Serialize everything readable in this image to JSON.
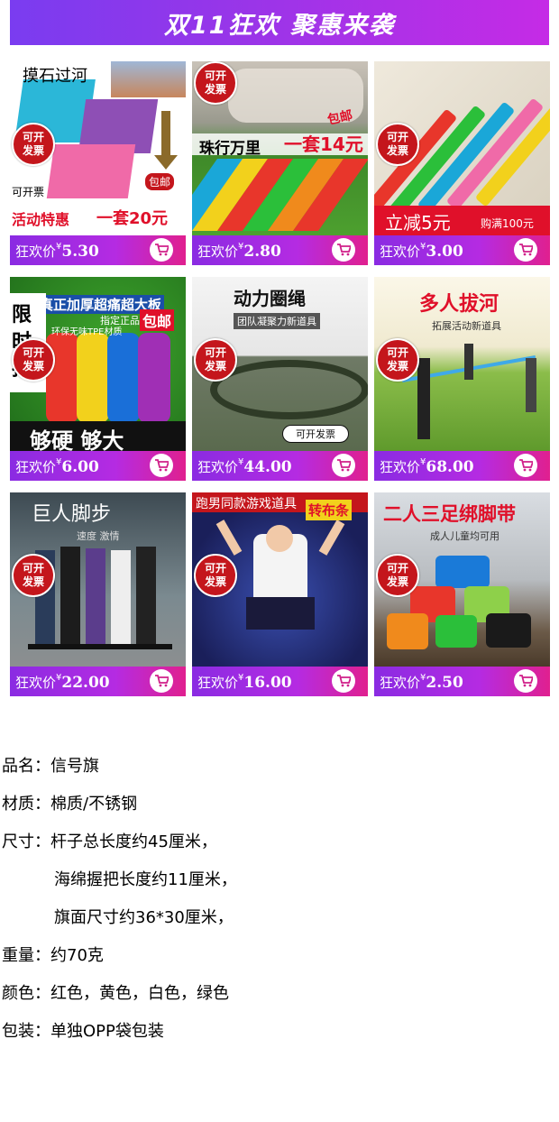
{
  "banner": {
    "title": "双11狂欢 聚惠来袭"
  },
  "price_prefix": "狂欢价",
  "currency": "¥",
  "invoice_badge": [
    "可开",
    "发票"
  ],
  "products": [
    {
      "price": "5.30",
      "texts": {
        "t1": "摸石过河",
        "t2": "可开票",
        "t3": "活动特惠",
        "t4": "一套20元",
        "t5": "包邮"
      }
    },
    {
      "price": "2.80",
      "texts": {
        "t1": "珠行万里",
        "t2": "一套14元",
        "t3": "包邮"
      }
    },
    {
      "price": "3.00",
      "texts": {
        "t1": "立减5元",
        "t2": "购满100元"
      }
    },
    {
      "price": "6.00",
      "texts": {
        "t1": "真正加厚超痛超大板",
        "t2": "指定正品",
        "t3": "环保无味TPE材质",
        "t4": "限时抢",
        "t5": "包邮",
        "t6": "够硬  够大"
      }
    },
    {
      "price": "44.00",
      "texts": {
        "t1": "动力圈绳",
        "t2": "团队凝聚力新道具",
        "t3": "可开发票"
      }
    },
    {
      "price": "68.00",
      "texts": {
        "t1": "多人拔河",
        "t2": "拓展活动新道具"
      }
    },
    {
      "price": "22.00",
      "texts": {
        "t1": "巨人脚步",
        "t2": "速度  激情"
      }
    },
    {
      "price": "16.00",
      "texts": {
        "t1": "跑男同款游戏道具",
        "t2": "转布条"
      }
    },
    {
      "price": "2.50",
      "texts": {
        "t1": "二人三足绑脚带",
        "t2": "成人儿童均可用"
      }
    }
  ],
  "specs": [
    {
      "label": "品名：",
      "value": "信号旗"
    },
    {
      "label": "材质：",
      "value": "棉质/不锈钢"
    },
    {
      "label": "尺寸：",
      "value": "杆子总长度约45厘米，"
    },
    {
      "label": "",
      "value": "海绵握把长度约11厘米，"
    },
    {
      "label": "",
      "value": "旗面尺寸约36*30厘米，"
    },
    {
      "label": "重量：",
      "value": "约70克"
    },
    {
      "label": "颜色：",
      "value": "红色，黄色，白色，绿色"
    },
    {
      "label": "包装：",
      "value": "单独OPP袋包装"
    }
  ],
  "colors": {
    "price_bar_start": "#8a2be2",
    "price_bar_end": "#e0208f",
    "badge": "#c4161c"
  }
}
